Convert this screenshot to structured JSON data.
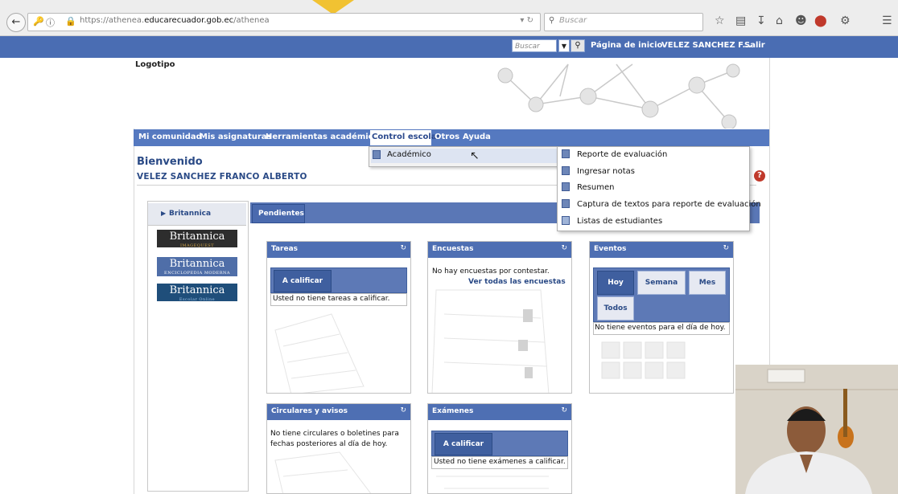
{
  "browser": {
    "url_prefix": "https://athenea.",
    "url_domain": "educarecuador.gob.ec",
    "url_path": "/athenea",
    "search_placeholder": "Buscar"
  },
  "topbar": {
    "search_placeholder": "Buscar",
    "home_link": "Página de inicio",
    "user_link": "VELEZ SANCHEZ F...",
    "logout_link": "Salir"
  },
  "logo": {
    "label": "Logotipo"
  },
  "nav": {
    "items": [
      "Mi comunidad",
      "Mis asignaturas",
      "Herramientas académicas",
      "Control escolar",
      "Otros",
      "Ayuda"
    ]
  },
  "submenu": {
    "item": "Académico",
    "subitems": [
      "Reporte de evaluación",
      "Ingresar notas",
      "Resumen",
      "Captura de textos para reporte de evaluación",
      "Listas de estudiantes"
    ]
  },
  "welcome": {
    "title": "Bienvenido",
    "name": "VELEZ SANCHEZ FRANCO ALBERTO"
  },
  "sidebar": {
    "section": "Britannica",
    "logos": [
      {
        "name": "Britannica",
        "sub": "IMAGEQUEST"
      },
      {
        "name": "Britannica",
        "sub": "ENCICLOPEDIA MODERNA"
      },
      {
        "name": "Britannica",
        "sub": "Escolar Online"
      }
    ]
  },
  "tabs": {
    "active": "Pendientes"
  },
  "widgets": {
    "tareas": {
      "title": "Tareas",
      "button": "A calificar",
      "empty": "Usted no tiene tareas a calificar."
    },
    "encuestas": {
      "title": "Encuestas",
      "empty": "No hay encuestas por contestar.",
      "link": "Ver todas las encuestas"
    },
    "eventos": {
      "title": "Eventos",
      "filters": [
        "Hoy",
        "Semana",
        "Mes",
        "Todos"
      ],
      "empty": "No tiene eventos para el día de hoy."
    },
    "circulares": {
      "title": "Circulares y avisos",
      "empty_line1": "No tiene circulares o boletines para",
      "empty_line2": "fechas posteriores al día de hoy."
    },
    "examenes": {
      "title": "Exámenes",
      "button": "A calificar",
      "empty": "Usted no tiene exámenes a calificar."
    }
  },
  "colors": {
    "topbar": "#4a6db3",
    "navbar": "#5579c0",
    "widget_header": "#4e6fb3",
    "accent_dark": "#3f5f9f"
  }
}
